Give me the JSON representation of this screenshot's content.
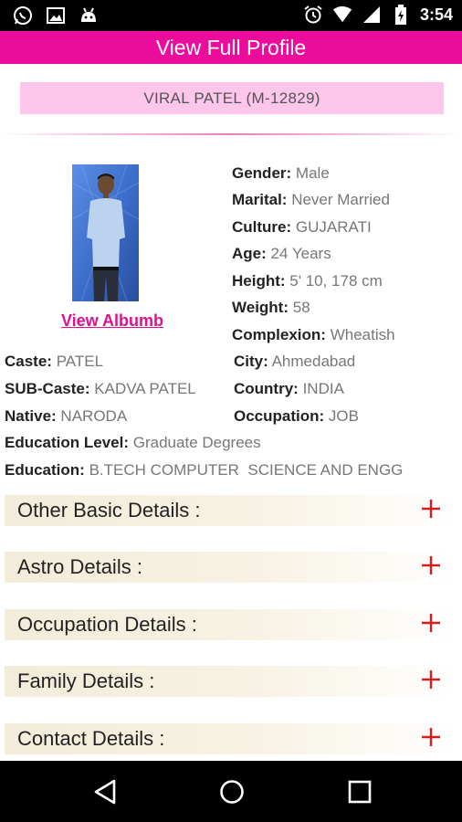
{
  "status_bar": {
    "time": "3:54",
    "icons_left": [
      "whatsapp-icon",
      "image-icon",
      "android-icon"
    ],
    "icons_right": [
      "alarm-icon",
      "wifi-icon",
      "signal-icon",
      "battery-icon"
    ]
  },
  "app_bar": {
    "title": "View Full Profile"
  },
  "profile": {
    "name_id": "VIRAL PATEL (M-12829)",
    "view_album": "View Albumb",
    "right_fields": [
      {
        "label": "Gender:",
        "value": "Male"
      },
      {
        "label": "Marital:",
        "value": "Never Married"
      },
      {
        "label": "Culture:",
        "value": "GUJARATI"
      },
      {
        "label": "Age:",
        "value": "24 Years"
      },
      {
        "label": "Height:",
        "value": "5' 10, 178 cm"
      },
      {
        "label": "Weight:",
        "value": "58"
      },
      {
        "label": "Complexion:",
        "value": "Wheatish"
      },
      {
        "label": "City:",
        "value": "Ahmedabad"
      },
      {
        "label": "Country:",
        "value": "INDIA"
      },
      {
        "label": "Occupation:",
        "value": "JOB"
      }
    ],
    "left_fields": [
      {
        "label": "Caste:",
        "value": "PATEL"
      },
      {
        "label": "SUB-Caste:",
        "value": "KADVA PATEL"
      },
      {
        "label": "Native:",
        "value": "NARODA"
      }
    ],
    "full_fields": [
      {
        "label": "Education Level:",
        "value": "Graduate Degrees"
      },
      {
        "label": "Education:",
        "value": "B.TECH COMPUTER  SCIENCE AND ENGG"
      }
    ]
  },
  "sections": [
    {
      "label": "Other Basic Details :"
    },
    {
      "label": "Astro Details :"
    },
    {
      "label": "Occupation Details :"
    },
    {
      "label": "Family Details :"
    },
    {
      "label": "Contact Details :"
    }
  ],
  "colors": {
    "accent": "#ec0c9c",
    "name_box": "#fdc6ea",
    "plus": "#d81b1b"
  }
}
